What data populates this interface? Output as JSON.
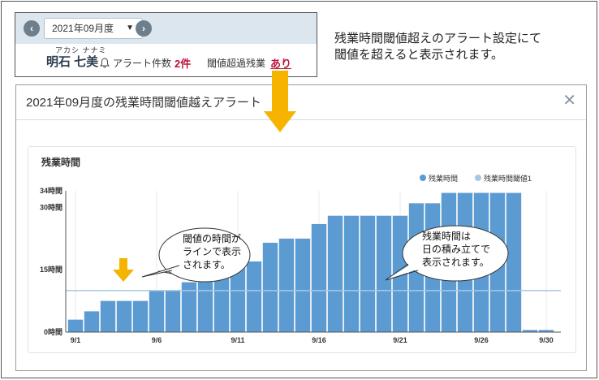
{
  "top": {
    "month": "2021年09月度",
    "furigana": "アカシ ナナミ",
    "name": "明石 七美",
    "alert_count_label": "アラート件数",
    "alert_count_value": "2件",
    "threshold_label": "閾値超過残業",
    "threshold_value": "あり"
  },
  "notes": {
    "top_line1": "残業時間閾値超えのアラート設定にて",
    "top_line2": "閾値を超えると表示されます。"
  },
  "modal": {
    "title": "2021年09月度の残業時間閾値越えアラート",
    "close": "✕"
  },
  "callouts": {
    "threshold_line1": "閾値の時間が",
    "threshold_line2": "ラインで表示",
    "threshold_line3": "されます。",
    "stacked_line1": "残業時間は",
    "stacked_line2": "日の積み立てで",
    "stacked_line3": "表示されます。"
  },
  "colors": {
    "bar": "#5b9bd2",
    "threshold": "#a9c7e4",
    "accent_red": "#c0143c",
    "arrow": "#f6b400"
  },
  "chart_data": {
    "type": "bar",
    "title": "残業時間",
    "ylabel": "",
    "xlabel": "",
    "ylim": [
      0,
      34
    ],
    "yticks": [
      {
        "value": 0,
        "label": "0時間"
      },
      {
        "value": 15,
        "label": "15時間"
      },
      {
        "value": 30,
        "label": "30時間"
      },
      {
        "value": 34,
        "label": "34時間"
      }
    ],
    "xticks": [
      {
        "day": 1,
        "label": "9/1"
      },
      {
        "day": 6,
        "label": "9/6"
      },
      {
        "day": 11,
        "label": "9/11"
      },
      {
        "day": 16,
        "label": "9/16"
      },
      {
        "day": 21,
        "label": "9/21"
      },
      {
        "day": 26,
        "label": "9/26"
      },
      {
        "day": 30,
        "label": "9/30"
      }
    ],
    "days": [
      1,
      2,
      3,
      4,
      5,
      6,
      7,
      8,
      9,
      10,
      11,
      12,
      13,
      14,
      15,
      16,
      17,
      18,
      19,
      20,
      21,
      22,
      23,
      24,
      25,
      26,
      27,
      28,
      29,
      30
    ],
    "series": [
      {
        "name": "残業時間",
        "values": [
          3,
          5,
          7.5,
          7.5,
          7.5,
          10,
          10,
          12,
          13,
          14.5,
          17,
          17,
          21.5,
          22.5,
          22.5,
          26,
          28,
          28,
          28,
          28,
          28,
          31,
          31,
          33.5,
          33.5,
          33.5,
          33.5,
          33.5,
          0.5,
          0.5
        ]
      }
    ],
    "threshold": {
      "name": "残業時間閾値1",
      "value": 10
    },
    "grid": true,
    "legend": "top-right"
  }
}
